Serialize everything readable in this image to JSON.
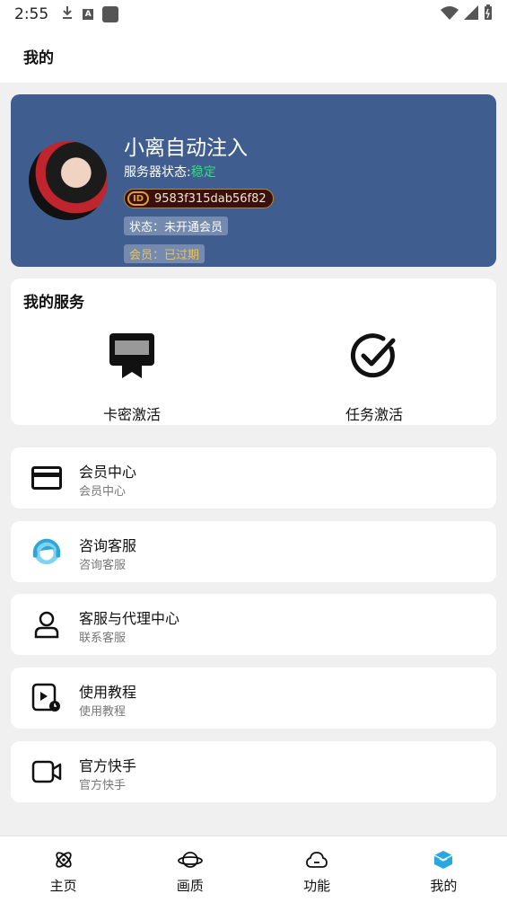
{
  "status_bar": {
    "time": "2:55",
    "icons": [
      "download-icon",
      "a-icon",
      "app-square-icon"
    ],
    "right_icons": [
      "wifi-icon",
      "signal-icon",
      "battery-icon"
    ]
  },
  "app_bar": {
    "title": "我的"
  },
  "profile": {
    "name": "小离自动注入",
    "server_status_label": "服务器状态:",
    "server_status_value": "稳定",
    "id_badge": "ID",
    "id_value": "9583f315dab56f82",
    "state_tag": "状态：未开通会员",
    "member_tag": "会员：已过期"
  },
  "services": {
    "title": "我的服务",
    "items": [
      {
        "label": "卡密激活",
        "icon": "card-key-icon"
      },
      {
        "label": "任务激活",
        "icon": "check-circle-icon"
      }
    ]
  },
  "menu": [
    {
      "title": "会员中心",
      "subtitle": "会员中心",
      "icon": "credit-card-icon"
    },
    {
      "title": "咨询客服",
      "subtitle": "咨询客服",
      "icon": "customer-service-icon"
    },
    {
      "title": "客服与代理中心",
      "subtitle": "联系客服",
      "icon": "user-icon"
    },
    {
      "title": "使用教程",
      "subtitle": "使用教程",
      "icon": "video-tutorial-icon"
    },
    {
      "title": "官方快手",
      "subtitle": "官方快手",
      "icon": "video-camera-icon"
    }
  ],
  "bottom_nav": [
    {
      "label": "主页",
      "icon": "atom-icon"
    },
    {
      "label": "画质",
      "icon": "planet-icon"
    },
    {
      "label": "功能",
      "icon": "cloud-icon"
    },
    {
      "label": "我的",
      "icon": "cube-icon",
      "active": true
    }
  ],
  "colors": {
    "profile_bg": "#3f5d8f",
    "status_ok": "#2ee07a",
    "member_expired": "#f0c24e",
    "active_nav": "#29a8e0"
  }
}
